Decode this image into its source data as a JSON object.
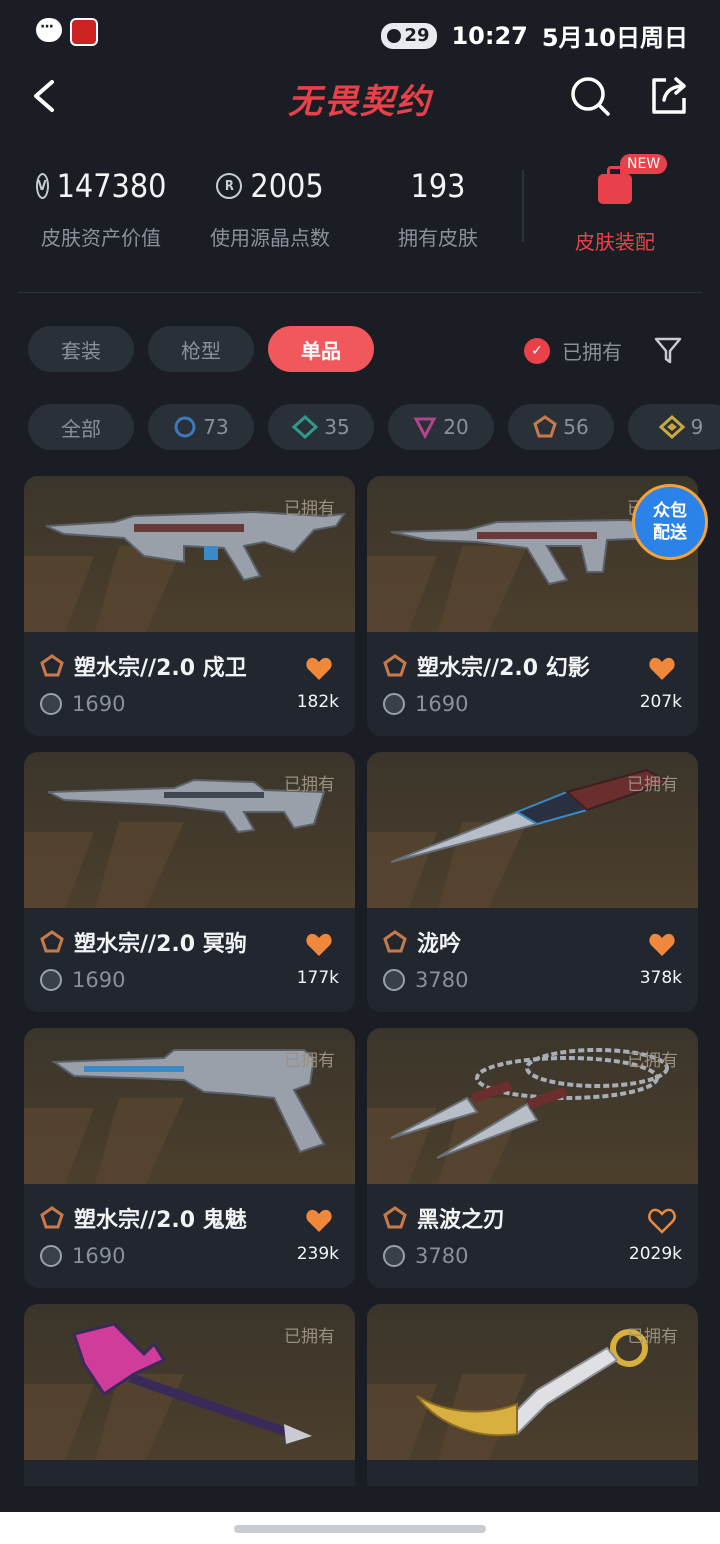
{
  "status_bar": {
    "battery": "29",
    "time": "10:27",
    "date": "5月10日周日"
  },
  "header": {
    "title": "无畏契约"
  },
  "stats": [
    {
      "value": "147380",
      "label": "皮肤资产价值",
      "icon": "vp-coin-icon"
    },
    {
      "value": "2005",
      "label": "使用源晶点数",
      "icon": "radianite-icon"
    },
    {
      "value": "193",
      "label": "拥有皮肤",
      "icon": ""
    }
  ],
  "equip": {
    "label": "皮肤装配",
    "badge": "NEW"
  },
  "tabs": [
    {
      "label": "套装",
      "active": false
    },
    {
      "label": "枪型",
      "active": false
    },
    {
      "label": "单品",
      "active": true
    }
  ],
  "owned_filter": {
    "label": "已拥有",
    "checked": true
  },
  "tier_chips": [
    {
      "label": "全部",
      "count": ""
    },
    {
      "label": "",
      "count": "73",
      "color": "#3a7ab8"
    },
    {
      "label": "",
      "count": "35",
      "color": "#2f9a8c"
    },
    {
      "label": "",
      "count": "20",
      "color": "#b0458c"
    },
    {
      "label": "",
      "count": "56",
      "color": "#c87a4a"
    },
    {
      "label": "",
      "count": "9",
      "color": "#c8a840"
    }
  ],
  "bundle_badge": {
    "line1": "众包",
    "line2": "配送"
  },
  "cards": [
    {
      "name": "塑水宗//2.0 戍卫",
      "price": "1690",
      "likes": "182k",
      "owned": "已拥有",
      "favorited": true
    },
    {
      "name": "塑水宗//2.0 幻影",
      "price": "1690",
      "likes": "207k",
      "owned": "已拥有",
      "favorited": true
    },
    {
      "name": "塑水宗//2.0 冥驹",
      "price": "1690",
      "likes": "177k",
      "owned": "已拥有",
      "favorited": true
    },
    {
      "name": "泷吟",
      "price": "3780",
      "likes": "378k",
      "owned": "已拥有",
      "favorited": true
    },
    {
      "name": "塑水宗//2.0 鬼魅",
      "price": "1690",
      "likes": "239k",
      "owned": "已拥有",
      "favorited": true
    },
    {
      "name": "黑波之刃",
      "price": "3780",
      "likes": "2029k",
      "owned": "已拥有",
      "favorited": false
    },
    {
      "name": "",
      "price": "",
      "likes": "",
      "owned": "已拥有",
      "favorited": false
    },
    {
      "name": "",
      "price": "",
      "likes": "",
      "owned": "已拥有",
      "favorited": false
    }
  ]
}
